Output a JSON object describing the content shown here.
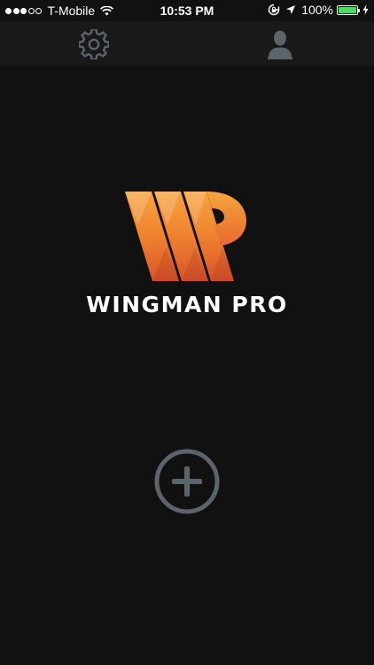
{
  "status_bar": {
    "carrier": "T-Mobile",
    "time": "10:53 PM",
    "battery_percent": "100%",
    "signal_bars_filled": 3,
    "signal_bars_total": 5,
    "battery_level": 1.0,
    "icons": [
      "wifi-icon",
      "rotation-lock-icon",
      "location-arrow-icon",
      "charging-bolt-icon"
    ]
  },
  "nav": {
    "left_icon": "gear-icon",
    "right_icon": "person-icon"
  },
  "logo": {
    "brand_name": "WINGMAN PRO"
  },
  "main": {
    "action_icon": "plus-circle-icon"
  },
  "colors": {
    "background": "#111111",
    "nav_background": "#191919",
    "icon_gray": "#5b636b",
    "logo_light": "#f29c38",
    "logo_dark": "#d9532b",
    "battery_green": "#4cd964"
  }
}
